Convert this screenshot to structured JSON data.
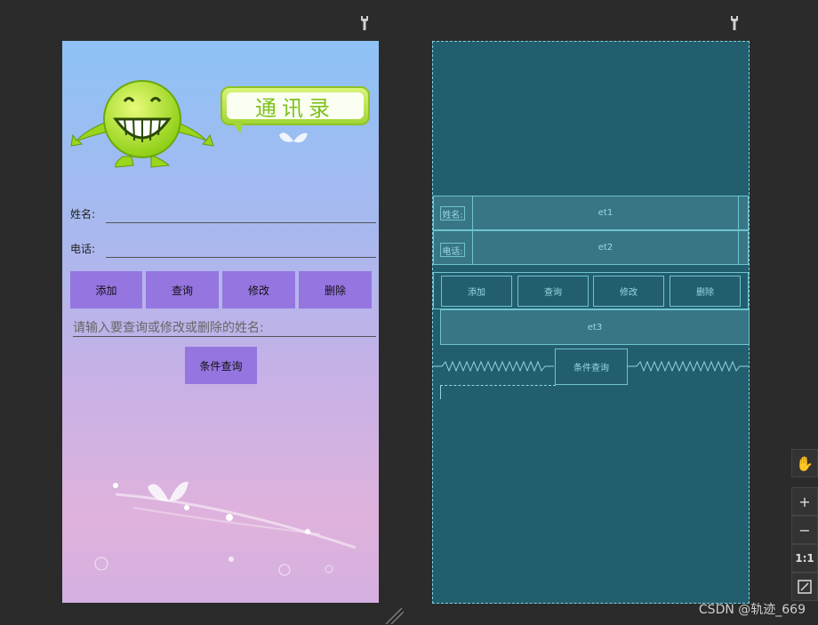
{
  "design": {
    "banner_text": "通讯录",
    "name_label": "姓名:",
    "phone_label": "电话:",
    "buttons": [
      "添加",
      "查询",
      "修改",
      "删除"
    ],
    "query_hint": "请输入要查询或修改或删除的姓名:",
    "condition_button": "条件查询"
  },
  "blueprint": {
    "name_label": "姓名:",
    "phone_label": "电话:",
    "et1": "et1",
    "et2": "et2",
    "et3": "et3",
    "buttons": [
      "添加",
      "查询",
      "修改",
      "删除"
    ],
    "condition_button": "条件查询"
  },
  "toolbar": {
    "zoom_in": "+",
    "zoom_out": "−",
    "actual_size": "1:1"
  },
  "watermark": "CSDN @轨迹_669",
  "colors": {
    "background": "#2b2b2b",
    "button": "#9575e0",
    "blueprint_bg": "#235e6e",
    "blueprint_line": "#6fc3d0"
  }
}
